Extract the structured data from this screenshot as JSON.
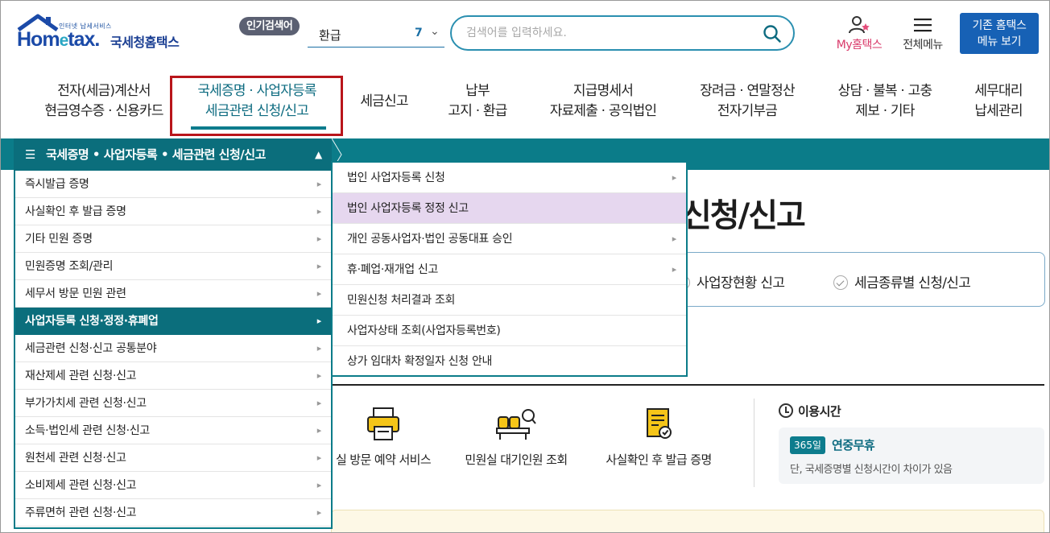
{
  "header": {
    "logo_sub": "인터넷 납세서비스",
    "logo_mark_a": "Hom",
    "logo_mark_e": "e",
    "logo_mark_b": "tax.",
    "logo_korean": "국세청홈택스",
    "popular_label": "인기검색어",
    "popular_keyword": "환급",
    "popular_rank": "7",
    "search_placeholder": "검색어를 입력하세요.",
    "my_home": "My홈택스",
    "all_menu": "전체메뉴",
    "old_line1": "기존 홈택스",
    "old_line2": "메뉴 보기"
  },
  "gnb": [
    {
      "line1": "전자(세금)계산서",
      "line2": "현금영수증 · 신용카드"
    },
    {
      "line1": "국세증명 · 사업자등록",
      "line2": "세금관련 신청/신고"
    },
    {
      "line1": "세금신고",
      "line2": ""
    },
    {
      "line1": "납부",
      "line2": "고지 · 환급"
    },
    {
      "line1": "지급명세서",
      "line2": "자료제출 · 공익법인"
    },
    {
      "line1": "장려금 · 연말정산",
      "line2": "전자기부금"
    },
    {
      "line1": "상담 · 불복 · 고충",
      "line2": "제보 · 기타"
    },
    {
      "line1": "세무대리",
      "line2": "납세관리"
    }
  ],
  "submenu_title": "국세증명 • 사업자등록 • 세금관련 신청/신고",
  "menu1": [
    "즉시발급 증명",
    "사실확인 후 발급 증명",
    "기타 민원 증명",
    "민원증명 조회/관리",
    "세무서 방문 민원 관련",
    "사업자등록 신청·정정·휴폐업",
    "세금관련 신청·신고 공통분야",
    "재산제세 관련 신청·신고",
    "부가가치세 관련 신청·신고",
    "소득·법인세 관련 신청·신고",
    "원천세 관련 신청·신고",
    "소비제세 관련 신청·신고",
    "주류면허 관련 신청·신고"
  ],
  "menu2": [
    "법인 사업자등록 신청",
    "법인 사업자등록 정정 신고",
    "개인 공동사업자·법인 공동대표 승인",
    "휴·폐업·재개업 신고",
    "민원신청 처리결과 조회",
    "사업자상태 조회(사업자등록번호)",
    "상가 임대차 확정일자 신청 안내"
  ],
  "content": {
    "title_tail": "신청/신고",
    "link1": "사업장현황 신고",
    "link2": "세금종류별 신청/신고",
    "svc1": "실 방문 예약 서비스",
    "svc2": "민원실 대기인원 조회",
    "svc3": "사실확인 후 발급 증명",
    "hours_title": "이용시간",
    "hours_badge": "365일",
    "hours_main": "연중무휴",
    "hours_note": "단, 국세증명별 신청시간이 차이가 있음"
  },
  "colors": {
    "teal": "#0b7c89",
    "brand_blue": "#1761b5",
    "highlight": "#e6d7ef",
    "red_box": "#b9151b"
  }
}
